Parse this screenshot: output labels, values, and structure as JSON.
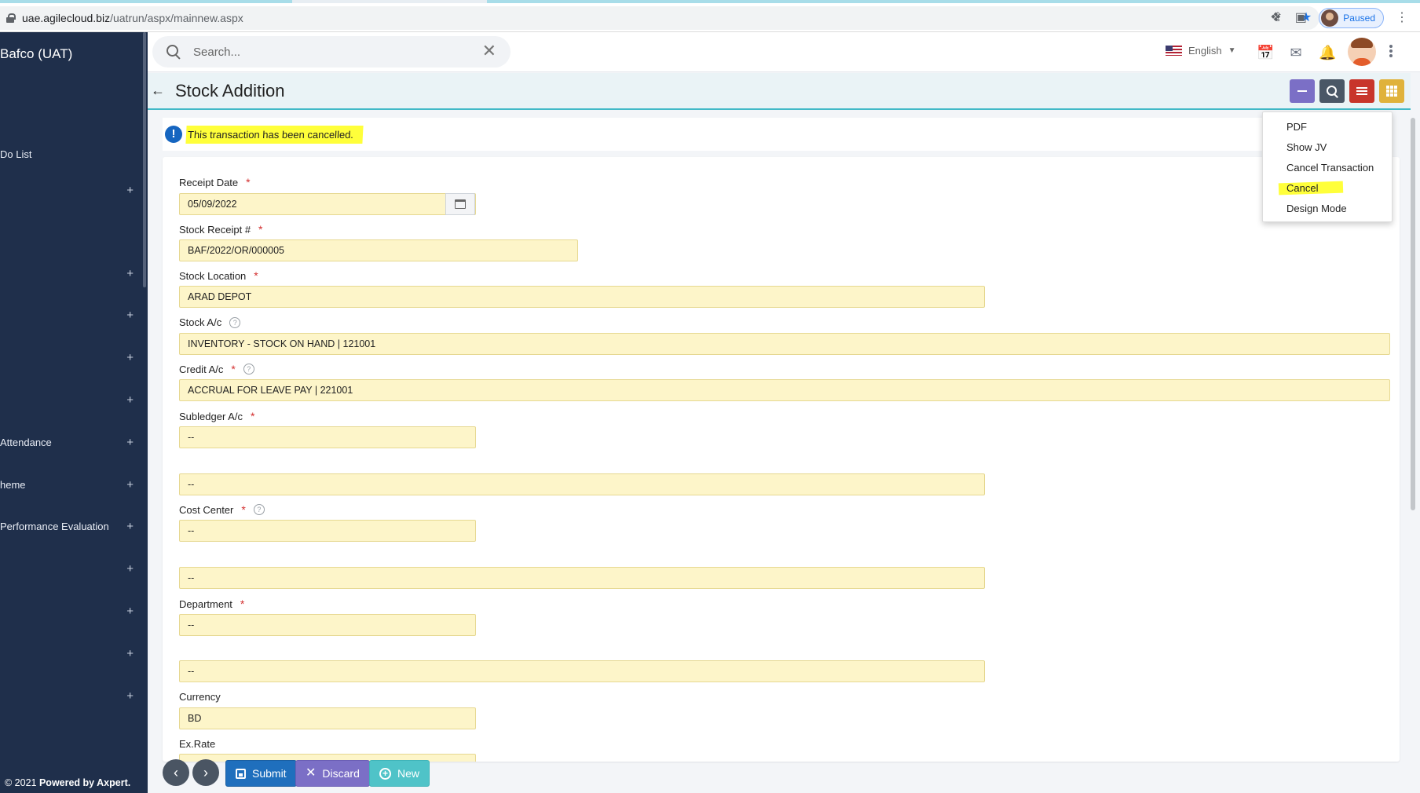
{
  "browser": {
    "url_host": "uae.agilecloud.biz",
    "url_path": "/uatrun/aspx/mainnew.aspx",
    "profile_status": "Paused"
  },
  "sidebar": {
    "brand": "Bafco (UAT)",
    "items": [
      {
        "label": "Do List",
        "has_plus": false
      },
      {
        "label": "",
        "has_plus": true
      },
      {
        "label": "",
        "has_plus": true
      },
      {
        "label": "",
        "has_plus": true
      },
      {
        "label": "",
        "has_plus": true
      },
      {
        "label": "",
        "has_plus": true
      },
      {
        "label": "Attendance",
        "has_plus": true
      },
      {
        "label": "heme",
        "has_plus": true
      },
      {
        "label": "Performance Evaluation",
        "has_plus": true
      },
      {
        "label": "",
        "has_plus": true
      },
      {
        "label": "",
        "has_plus": true
      },
      {
        "label": "",
        "has_plus": true
      },
      {
        "label": "",
        "has_plus": true
      }
    ],
    "footer_prefix": "© 2021 ",
    "footer_bold": "Powered by Axpert."
  },
  "topbar": {
    "search_placeholder": "Search...",
    "language": "English"
  },
  "page": {
    "title": "Stock Addition",
    "alert": "This transaction has been cancelled."
  },
  "form": {
    "receipt_date_label": "Receipt Date",
    "receipt_date_value": "05/09/2022",
    "stock_receipt_label": "Stock Receipt #",
    "stock_receipt_value": "BAF/2022/OR/000005",
    "stock_location_label": "Stock Location",
    "stock_location_value": "ARAD DEPOT",
    "stock_ac_label": "Stock A/c",
    "stock_ac_value": "INVENTORY - STOCK ON HAND | 121001",
    "credit_ac_label": "Credit A/c",
    "credit_ac_value": "ACCRUAL FOR LEAVE PAY | 221001",
    "subledger_label": "Subledger A/c",
    "subledger_value": "--",
    "subledger_desc_value": "--",
    "cost_center_label": "Cost Center",
    "cost_center_value": "--",
    "cost_center_desc_value": "--",
    "department_label": "Department",
    "department_value": "--",
    "department_desc_value": "--",
    "currency_label": "Currency",
    "currency_value": "BD",
    "exrate_label": "Ex.Rate",
    "required_mark": "*",
    "help_mark": "?"
  },
  "menu": {
    "items": [
      "PDF",
      "Show JV",
      "Cancel Transaction",
      "Cancel",
      "Design Mode"
    ],
    "highlighted": "Cancel"
  },
  "toolbar": {
    "submit": "Submit",
    "discard": "Discard",
    "new": "New"
  },
  "colors": {
    "sidebar": "#1f2f4b",
    "field_bg": "#fdf5c9",
    "highlight": "#ffff3a",
    "accent": "#42b9c7"
  }
}
